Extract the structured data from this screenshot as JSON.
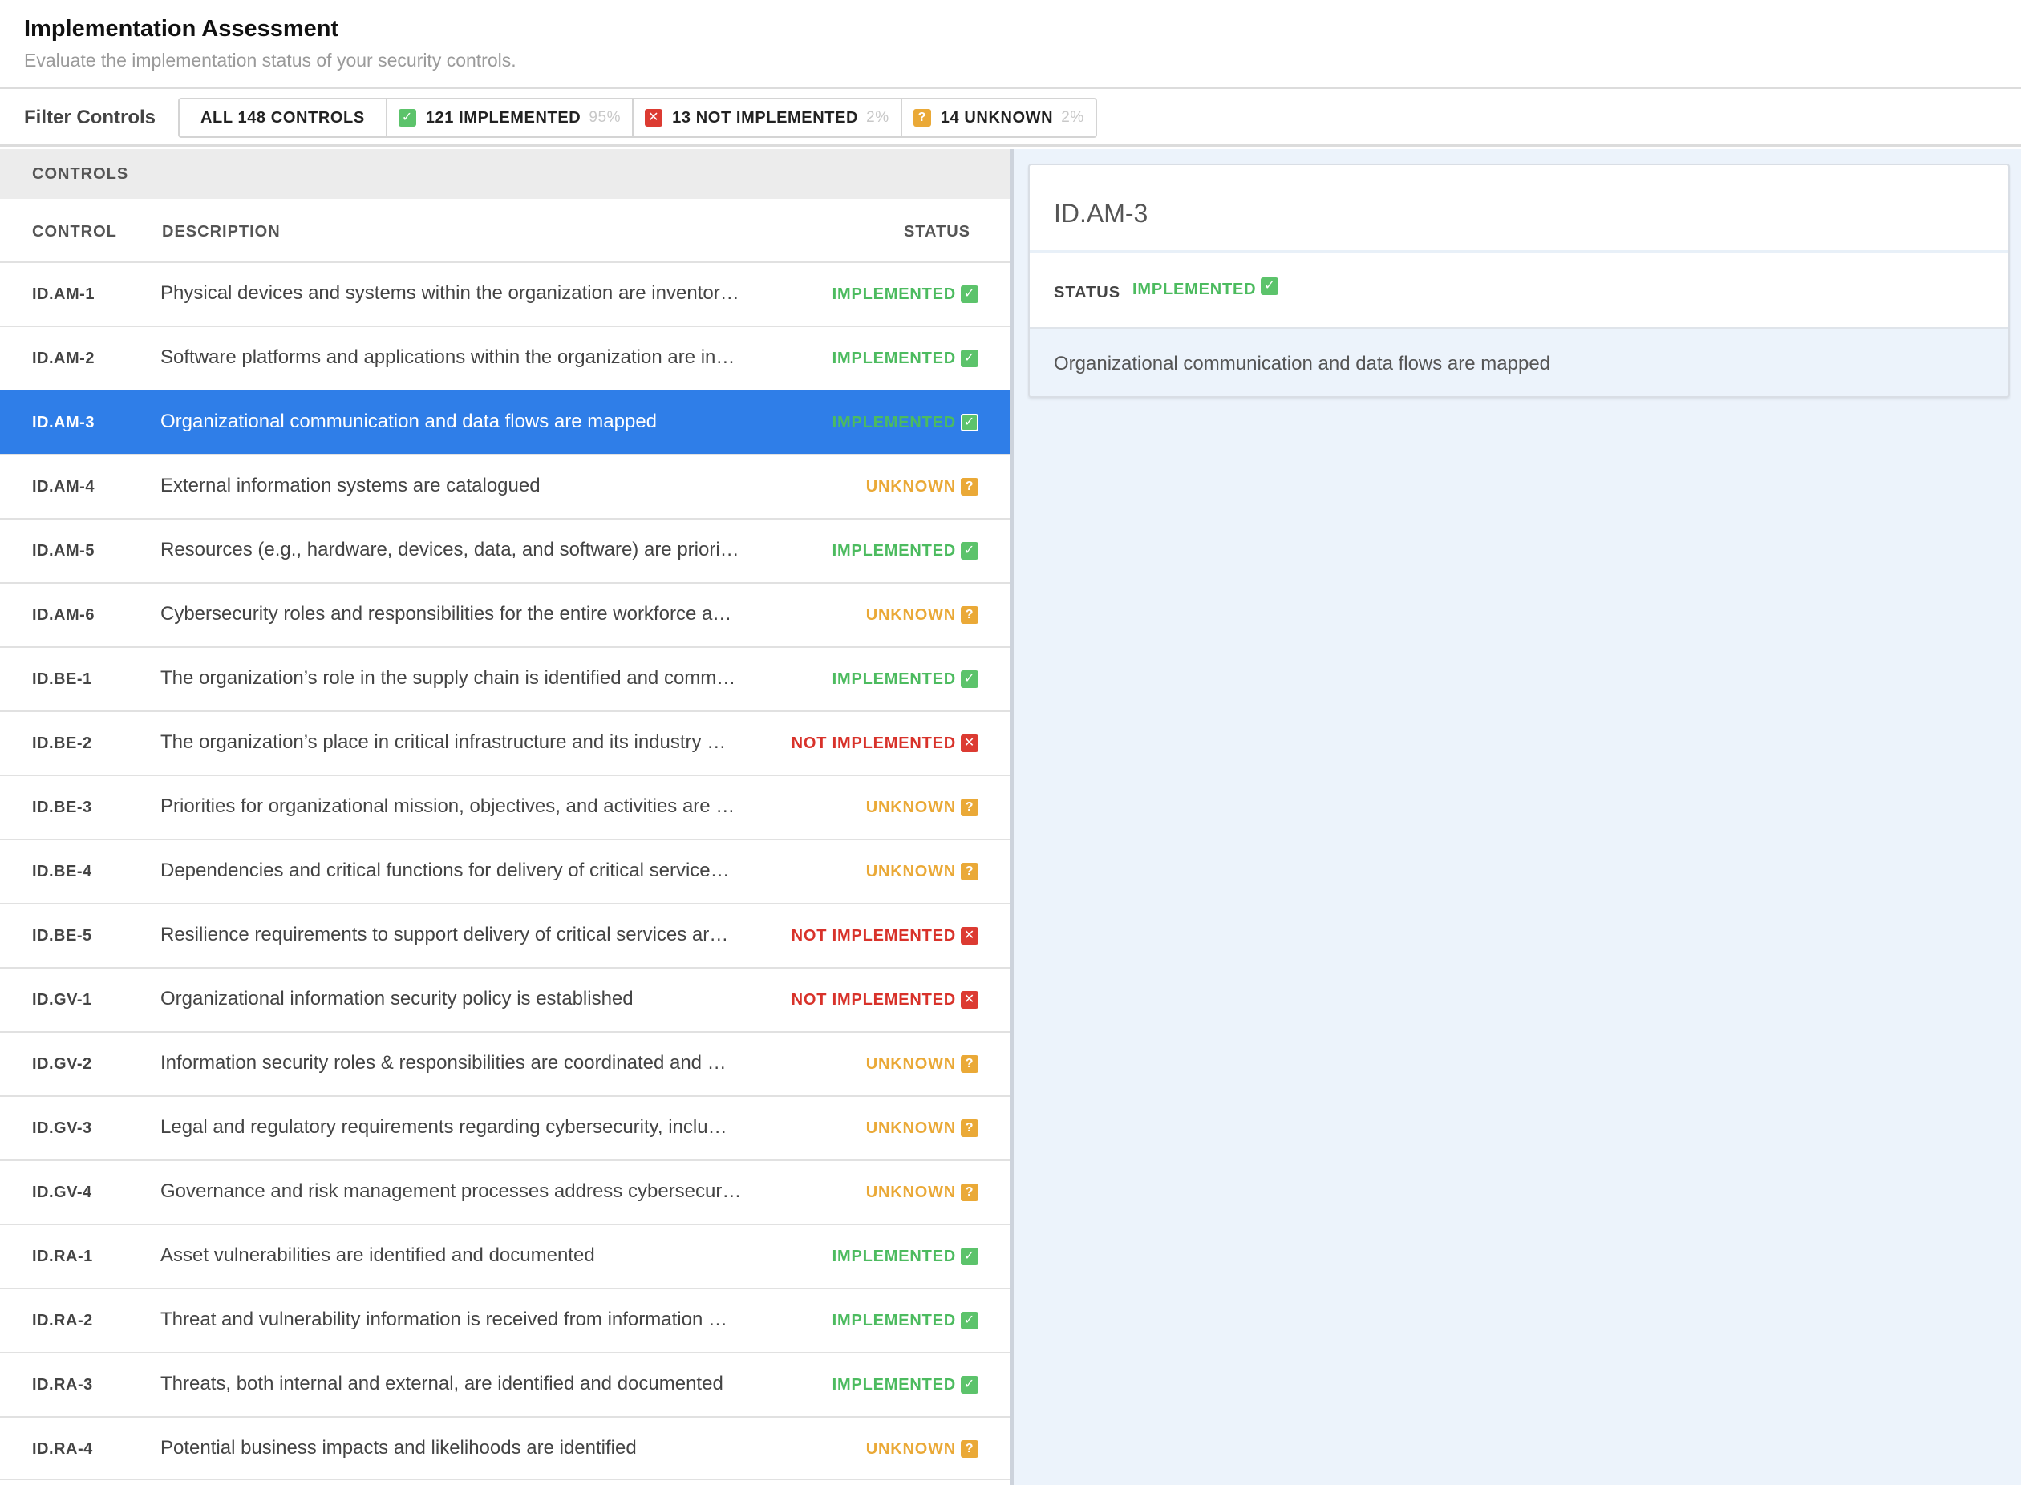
{
  "header": {
    "title": "Implementation Assessment",
    "subtitle": "Evaluate the implementation status of your security controls."
  },
  "filter": {
    "label": "Filter Controls",
    "buttons": [
      {
        "label": "ALL 148 CONTROLS",
        "pct": "",
        "badge": "",
        "badge_icon": ""
      },
      {
        "label": "121 IMPLEMENTED",
        "pct": "95%",
        "badge": "✓",
        "badge_icon": "check-icon"
      },
      {
        "label": "13 NOT IMPLEMENTED",
        "pct": "2%",
        "badge": "✕",
        "badge_icon": "x-icon"
      },
      {
        "label": "14 UNKNOWN",
        "pct": "2%",
        "badge": "?",
        "badge_icon": "question-icon"
      }
    ]
  },
  "controls": {
    "heading": "CONTROLS",
    "columns": {
      "control": "CONTROL",
      "description": "DESCRIPTION",
      "status": "STATUS"
    },
    "selected_index": 2,
    "rows": [
      {
        "id": "ID.AM-1",
        "desc": "Physical devices and systems within the organization are inventor…",
        "status": "IMPLEMENTED",
        "kind": "ok"
      },
      {
        "id": "ID.AM-2",
        "desc": "Software platforms and applications within the organization are in…",
        "status": "IMPLEMENTED",
        "kind": "ok"
      },
      {
        "id": "ID.AM-3",
        "desc": "Organizational communication and data flows are mapped",
        "status": "IMPLEMENTED",
        "kind": "ok"
      },
      {
        "id": "ID.AM-4",
        "desc": "External information systems are catalogued",
        "status": "UNKNOWN",
        "kind": "unk"
      },
      {
        "id": "ID.AM-5",
        "desc": "Resources (e.g., hardware, devices, data, and software) are priori…",
        "status": "IMPLEMENTED",
        "kind": "ok"
      },
      {
        "id": "ID.AM-6",
        "desc": "Cybersecurity roles and responsibilities for the entire workforce a…",
        "status": "UNKNOWN",
        "kind": "unk"
      },
      {
        "id": "ID.BE-1",
        "desc": "The organization’s role in the supply chain is identified and comm…",
        "status": "IMPLEMENTED",
        "kind": "ok"
      },
      {
        "id": "ID.BE-2",
        "desc": "The organization’s place in critical infrastructure and its industry …",
        "status": "NOT IMPLEMENTED",
        "kind": "bad"
      },
      {
        "id": "ID.BE-3",
        "desc": "Priorities for organizational mission, objectives, and activities are …",
        "status": "UNKNOWN",
        "kind": "unk"
      },
      {
        "id": "ID.BE-4",
        "desc": "Dependencies and critical functions for delivery of critical service…",
        "status": "UNKNOWN",
        "kind": "unk"
      },
      {
        "id": "ID.BE-5",
        "desc": "Resilience requirements to support delivery of critical services ar…",
        "status": "NOT IMPLEMENTED",
        "kind": "bad"
      },
      {
        "id": "ID.GV-1",
        "desc": "Organizational information security policy is established",
        "status": "NOT IMPLEMENTED",
        "kind": "bad"
      },
      {
        "id": "ID.GV-2",
        "desc": "Information security roles & responsibilities are coordinated and …",
        "status": "UNKNOWN",
        "kind": "unk"
      },
      {
        "id": "ID.GV-3",
        "desc": "Legal and regulatory requirements regarding cybersecurity, inclu…",
        "status": "UNKNOWN",
        "kind": "unk"
      },
      {
        "id": "ID.GV-4",
        "desc": "Governance and risk management processes address cybersecur…",
        "status": "UNKNOWN",
        "kind": "unk"
      },
      {
        "id": "ID.RA-1",
        "desc": "Asset vulnerabilities are identified and documented",
        "status": "IMPLEMENTED",
        "kind": "ok"
      },
      {
        "id": "ID.RA-2",
        "desc": "Threat and vulnerability information is received from information …",
        "status": "IMPLEMENTED",
        "kind": "ok"
      },
      {
        "id": "ID.RA-3",
        "desc": "Threats, both internal and external, are identified and documented",
        "status": "IMPLEMENTED",
        "kind": "ok"
      },
      {
        "id": "ID.RA-4",
        "desc": "Potential business impacts and likelihoods are identified",
        "status": "UNKNOWN",
        "kind": "unk"
      }
    ]
  },
  "detail": {
    "title": "ID.AM-3",
    "status_label": "STATUS",
    "status": "IMPLEMENTED",
    "status_badge": "✓",
    "status_icon": "check-icon",
    "description": "Organizational communication and data flows are mapped"
  },
  "colors": {
    "implemented": "#4cbb5f",
    "not_implemented": "#d8322a",
    "unknown": "#eaa937",
    "selected_row": "#2f7ee8",
    "detail_background": "#ecf3fb"
  },
  "badge_glyphs": {
    "ok": "✓",
    "bad": "✕",
    "unk": "?"
  }
}
